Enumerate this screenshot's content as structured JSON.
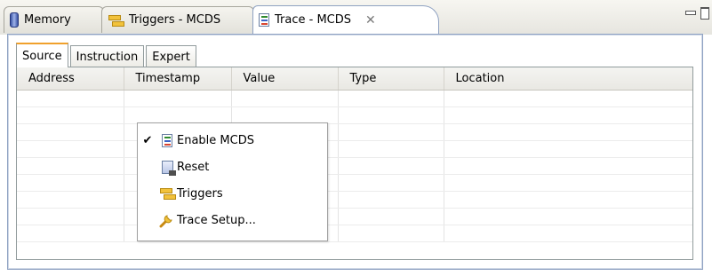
{
  "view_tabs": [
    {
      "label": "Memory",
      "icon": "database-icon"
    },
    {
      "label": "Triggers - MCDS",
      "icon": "triggers-icon"
    },
    {
      "label": "Trace - MCDS",
      "icon": "trace-icon",
      "close_icon": "close-icon",
      "active": true
    }
  ],
  "window_controls": {
    "minimize": "minimize-icon",
    "maximize": "maximize-icon"
  },
  "sub_tabs": [
    {
      "label": "Source",
      "active": true
    },
    {
      "label": "Instruction"
    },
    {
      "label": "Expert"
    }
  ],
  "table": {
    "columns": [
      "Address",
      "Timestamp",
      "Value",
      "Type",
      "Location"
    ],
    "rows": 9
  },
  "context_menu": {
    "items": [
      {
        "label": "Enable MCDS",
        "checked": true,
        "icon": "trace-icon"
      },
      {
        "label": "Reset",
        "checked": false,
        "icon": "reset-icon"
      },
      {
        "label": "Triggers",
        "checked": false,
        "icon": "triggers-icon"
      },
      {
        "label": "Trace Setup...",
        "checked": false,
        "icon": "wrench-icon"
      }
    ],
    "check_glyph": "✔"
  },
  "colors": {
    "active_tab_border": "#8fa2c2",
    "subtab_accent": "#f0a12c"
  }
}
